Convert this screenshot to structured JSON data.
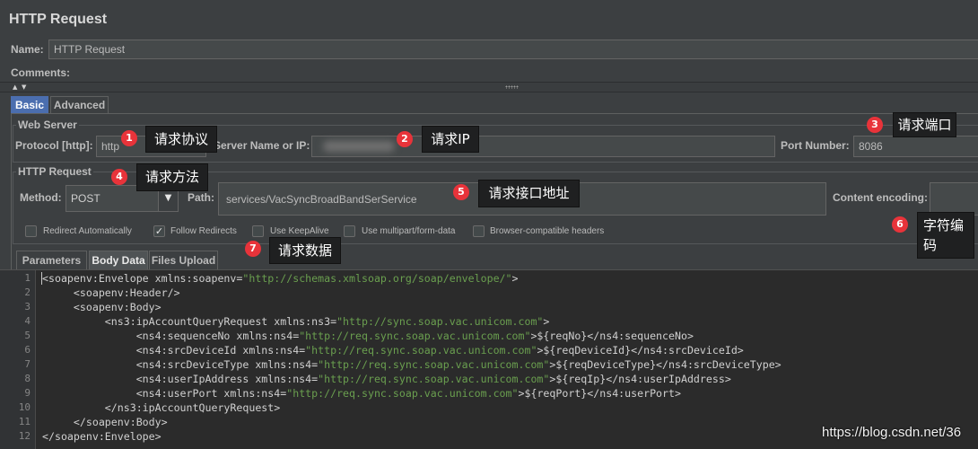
{
  "panel": {
    "title": "HTTP Request"
  },
  "name_field": {
    "label": "Name:",
    "value": "HTTP Request"
  },
  "comments": {
    "label": "Comments:"
  },
  "tabs": [
    {
      "label": "Basic",
      "selected": true
    },
    {
      "label": "Advanced",
      "selected": false
    }
  ],
  "web_server": {
    "legend": "Web Server",
    "protocol": {
      "label": "Protocol [http]:",
      "value": "http"
    },
    "server": {
      "label": "Server Name or IP:"
    },
    "port": {
      "label": "Port Number:",
      "value": "8086"
    }
  },
  "http_request": {
    "legend": "HTTP Request",
    "method": {
      "label": "Method:",
      "value": "POST"
    },
    "path": {
      "label": "Path:",
      "value": "services/VacSyncBroadBandSerService"
    },
    "encoding": {
      "label": "Content encoding:"
    }
  },
  "options": [
    {
      "label": "Redirect Automatically",
      "checked": false
    },
    {
      "label": "Follow Redirects",
      "checked": true
    },
    {
      "label": "Use KeepAlive",
      "checked": false
    },
    {
      "label": "Use multipart/form-data",
      "checked": false
    },
    {
      "label": "Browser-compatible headers",
      "checked": false
    }
  ],
  "body_tabs": [
    {
      "label": "Parameters",
      "selected": false
    },
    {
      "label": "Body Data",
      "selected": true
    },
    {
      "label": "Files Upload",
      "selected": false
    }
  ],
  "body_data": {
    "lines": [
      {
        "n": "1",
        "text": "<soapenv:Envelope xmlns:soapenv=\"http://schemas.xmlsoap.org/soap/envelope/\">"
      },
      {
        "n": "2",
        "text": "     <soapenv:Header/>"
      },
      {
        "n": "3",
        "text": "     <soapenv:Body>"
      },
      {
        "n": "4",
        "text": "          <ns3:ipAccountQueryRequest xmlns:ns3=\"http://sync.soap.vac.unicom.com\">"
      },
      {
        "n": "5",
        "text": "               <ns4:sequenceNo xmlns:ns4=\"http://req.sync.soap.vac.unicom.com\">${reqNo}</ns4:sequenceNo>"
      },
      {
        "n": "6",
        "text": "               <ns4:srcDeviceId xmlns:ns4=\"http://req.sync.soap.vac.unicom.com\">${reqDeviceId}</ns4:srcDeviceId>"
      },
      {
        "n": "7",
        "text": "               <ns4:srcDeviceType xmlns:ns4=\"http://req.sync.soap.vac.unicom.com\">${reqDeviceType}</ns4:srcDeviceType>"
      },
      {
        "n": "8",
        "text": "               <ns4:userIpAddress xmlns:ns4=\"http://req.sync.soap.vac.unicom.com\">${reqIp}</ns4:userIpAddress>"
      },
      {
        "n": "9",
        "text": "               <ns4:userPort xmlns:ns4=\"http://req.sync.soap.vac.unicom.com\">${reqPort}</ns4:userPort>"
      },
      {
        "n": "10",
        "text": "          </ns3:ipAccountQueryRequest>"
      },
      {
        "n": "11",
        "text": "     </soapenv:Body>"
      },
      {
        "n": "12",
        "text": "</soapenv:Envelope>"
      }
    ]
  },
  "annotations": [
    {
      "number": "1",
      "text": "请求协议"
    },
    {
      "number": "2",
      "text": "请求IP"
    },
    {
      "number": "3",
      "text": "请求端口"
    },
    {
      "number": "4",
      "text": "请求方法"
    },
    {
      "number": "5",
      "text": "请求接口地址"
    },
    {
      "number": "6",
      "text": "字符编码"
    },
    {
      "number": "7",
      "text": "请求数据"
    }
  ],
  "watermark": "https://blog.csdn.net/36",
  "icons": {
    "splitter_up": "collapse-up-icon",
    "splitter_down": "expand-down-icon",
    "splitter_grip": "splitter-grip-icon",
    "method_dropdown": "chevron-down-icon",
    "checkbox_mark": "checkmark-icon"
  },
  "colors": {
    "panel_bg": "#3c3f41",
    "selected_tab": "#4b6eaf",
    "editor_bg": "#2b2b2b",
    "xml_string": "#6a9f4f",
    "annotation_badge": "#e8333a",
    "annotation_box": "#1f2021"
  }
}
